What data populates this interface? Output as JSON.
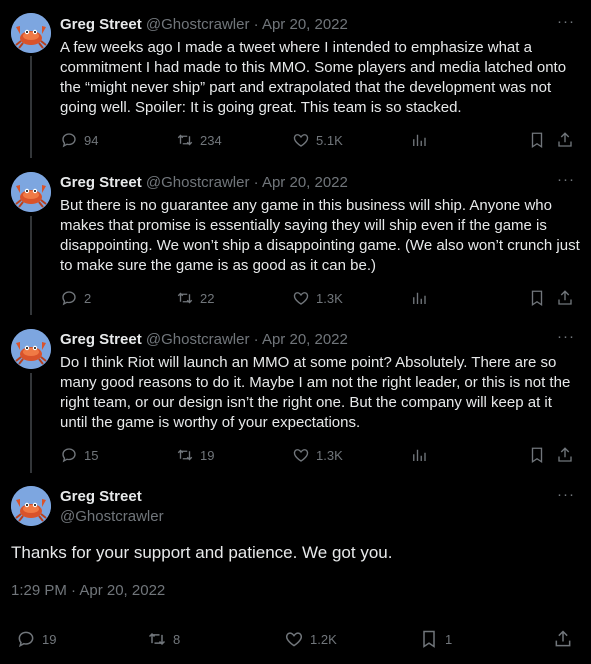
{
  "author": {
    "name": "Greg Street",
    "handle": "@Ghostcrawler"
  },
  "thread": [
    {
      "meta": "@Ghostcrawler · Apr 20, 2022",
      "text": "A few weeks ago I made a tweet where I intended to emphasize what a commitment I had made to this MMO. Some players and media latched onto the “might never ship” part and extrapolated that the development was not going well. Spoiler: It is going great. This team is so stacked.",
      "replies": "94",
      "retweets": "234",
      "likes": "5.1K"
    },
    {
      "meta": "@Ghostcrawler · Apr 20, 2022",
      "text": "But there is no guarantee any game in this business will ship. Anyone who makes that promise is essentially saying they will ship even if the game is disappointing. We won’t ship a disappointing game. (We also won’t crunch just to make sure the game is as good as it can be.)",
      "replies": "2",
      "retweets": "22",
      "likes": "1.3K"
    },
    {
      "meta": "@Ghostcrawler · Apr 20, 2022",
      "text": "Do I think Riot will launch an MMO at some point? Absolutely. There are so many good reasons to do it. Maybe I am not the right leader, or this is not the right team, or our design isn’t the right one. But the company will keep at it until the game is worthy of your expectations.",
      "replies": "15",
      "retweets": "19",
      "likes": "1.3K"
    }
  ],
  "main_tweet": {
    "text": "Thanks for your support and patience. We got you.",
    "timestamp": "1:29 PM · Apr 20, 2022",
    "replies": "19",
    "retweets": "8",
    "likes": "1.2K",
    "bookmarks": "1"
  },
  "more_label": "···",
  "colors": {
    "background": "#000000",
    "text": "#e7e9ea",
    "muted": "#71767b",
    "avatar_bg": "#7da6e0",
    "crab": "#d9532b"
  },
  "icons": [
    "reply-icon",
    "retweet-icon",
    "like-icon",
    "views-icon",
    "bookmark-icon",
    "share-icon",
    "more-icon"
  ]
}
